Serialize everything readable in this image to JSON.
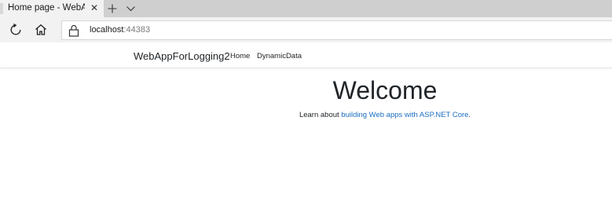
{
  "browser": {
    "tab": {
      "title": "Home page - WebAppF",
      "close_glyph": "✕",
      "icons": {
        "close": "close-icon",
        "new_tab": "plus-icon",
        "tab_list": "chevron-down-icon"
      }
    },
    "toolbar": {
      "icons": {
        "refresh": "refresh-icon",
        "home": "home-icon",
        "lock": "lock-icon"
      },
      "url_host": "localhost",
      "url_port": ":44383"
    }
  },
  "site": {
    "brand": "WebAppForLogging2",
    "nav": [
      {
        "label": "Home"
      },
      {
        "label": "DynamicData"
      }
    ]
  },
  "content": {
    "heading": "Welcome",
    "learn_prefix": "Learn about ",
    "learn_link": "building Web apps with ASP.NET Core",
    "learn_suffix": "."
  },
  "colors": {
    "link": "#1b6ec2",
    "text": "#212529",
    "tabstrip": "#cfcfcf",
    "toolbar": "#f2f2f2"
  }
}
